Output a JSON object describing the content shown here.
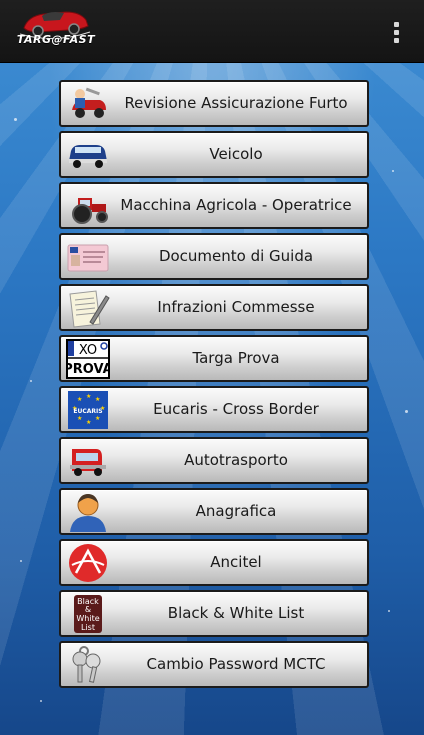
{
  "app": {
    "logo_text": "TARG@FAST"
  },
  "menu": {
    "items": [
      {
        "label": "Revisione Assicurazione Furto",
        "icon": "mechanic-car-icon"
      },
      {
        "label": "Veicolo",
        "icon": "car-icon"
      },
      {
        "label": "Macchina Agricola - Operatrice",
        "icon": "tractor-icon"
      },
      {
        "label": "Documento di Guida",
        "icon": "driving-license-icon"
      },
      {
        "label": "Infrazioni Commesse",
        "icon": "document-pen-icon"
      },
      {
        "label": "Targa Prova",
        "icon": "test-plate-icon",
        "plate_top": "XO",
        "plate_bottom": "PROVA"
      },
      {
        "label": "Eucaris - Cross Border",
        "icon": "eucaris-flag-icon",
        "flag_text": "EUCARIS"
      },
      {
        "label": "Autotrasporto",
        "icon": "truck-icon"
      },
      {
        "label": "Anagrafica",
        "icon": "person-icon"
      },
      {
        "label": "Ancitel",
        "icon": "ancitel-logo-icon"
      },
      {
        "label": "Black & White List",
        "icon": "black-white-list-icon",
        "icon_text": [
          "Black",
          "&",
          "White",
          "List"
        ]
      },
      {
        "label": "Cambio Password MCTC",
        "icon": "keys-icon"
      }
    ]
  }
}
